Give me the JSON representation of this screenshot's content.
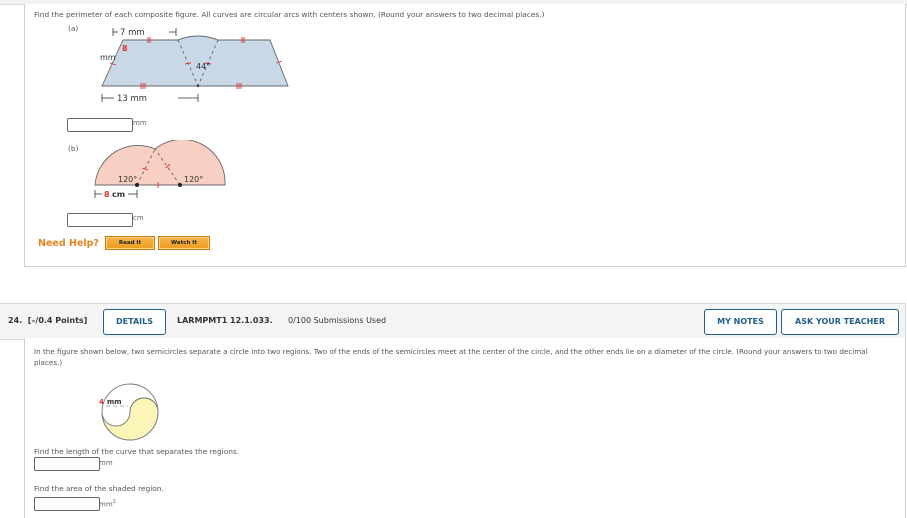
{
  "q23": {
    "instruction": "Find the perimeter of each composite figure. All curves are circular arcs with centers shown. (Round your answers to two decimal places.)",
    "part_a": {
      "label": "(a)",
      "top_dim": "7 mm",
      "side_value": "8",
      "side_unit": "mm",
      "angle": "44°",
      "bottom_dim": "13 mm",
      "answer_value": "",
      "unit": "mm"
    },
    "part_b": {
      "label": "(b)",
      "angle_left": "120°",
      "angle_right": "120°",
      "dim_value": "8",
      "dim_unit": "cm",
      "answer_value": "",
      "unit": "cm"
    },
    "need_help": "Need Help?",
    "read_it": "Read It",
    "watch_it": "Watch It"
  },
  "q24": {
    "number": "24.",
    "points": "[–/0.4 Points]",
    "details_button": "DETAILS",
    "code": "LARMPMT1 12.1.033.",
    "submissions": "0/100 Submissions Used",
    "my_notes_button": "MY NOTES",
    "ask_teacher_button": "ASK YOUR TEACHER",
    "problem_text": "In the figure shown below, two semicircles separate a circle into two regions. Two of the ends of the semicircles meet at the center of the circle, and the other ends lie on a diameter of the circle. (Round your answers to two decimal places.)",
    "figure": {
      "radius_value": "4",
      "radius_unit": "mm"
    },
    "q1_prompt": "Find the length of the curve that separates the regions.",
    "q1_value": "",
    "q1_unit": "mm",
    "q2_prompt": "Find the area of the shaded region.",
    "q2_value": "",
    "q2_unit": "mm",
    "q2_unit_exp": "2"
  },
  "colors": {
    "accent_blue": "#1f5f8b",
    "help_orange": "#e8821e",
    "figure_blue": "#c9d8e6",
    "figure_pink": "#f8cfc3",
    "figure_yellow": "#fbf5b8",
    "tick_red": "#e03030"
  }
}
